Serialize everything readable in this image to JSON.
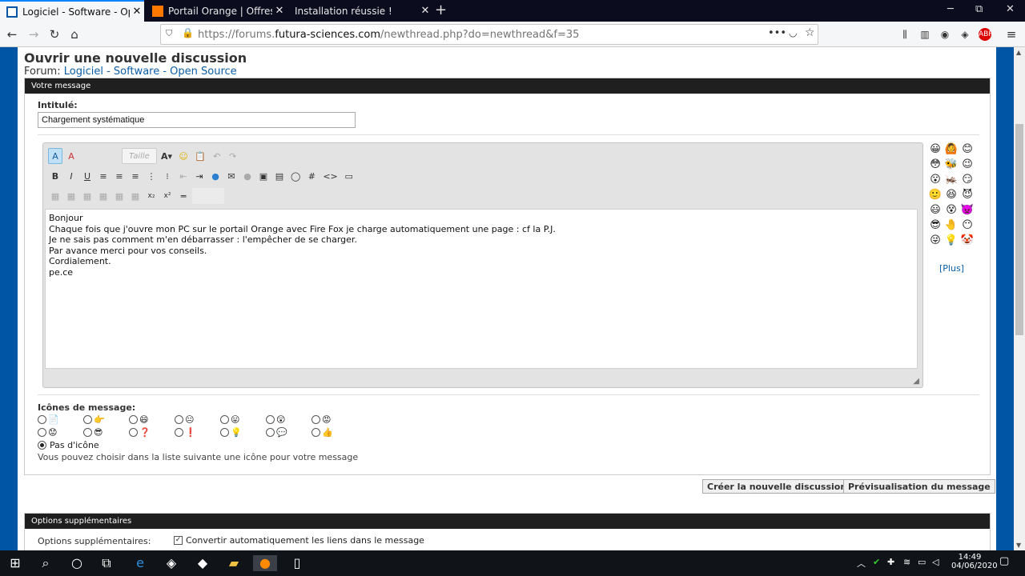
{
  "tabs": [
    {
      "title": "Logiciel - Software - Open",
      "close": "✕",
      "active": true
    },
    {
      "title": "Portail Orange | Offres Mo",
      "close": "✕",
      "active": false
    },
    {
      "title": "Installation réussie !",
      "close": "✕",
      "active": false
    }
  ],
  "newtab": "+",
  "window": {
    "min": "─",
    "max": "⧉",
    "close": "✕"
  },
  "url": {
    "prefix": "https://forums.",
    "domain": "futura-sciences.com",
    "path": "/newthread.php?do=newthread&f=35"
  },
  "page": {
    "title": "Ouvrir une nouvelle discussion",
    "forum_label": "Forum:",
    "forum_link": "Logiciel - Software - Open Source",
    "section_message": "Votre message",
    "intitule_label": "Intitulé:",
    "intitule_value": "Chargement systématique",
    "font_placeholder": "Taille",
    "message_text": "Bonjour\nChaque fois que j'ouvre mon PC sur le portail Orange avec Fire Fox je charge automatiquement une page : cf la P.J.\nJe ne sais pas comment m'en débarrasser : l'empêcher de se charger.\nPar avance merci pour vos conseils.\nCordialement.\npe.ce",
    "plus_link": "[Plus]",
    "icons_label": "Icônes de message:",
    "no_icon": "Pas d'icône",
    "icons_hint": "Vous pouvez choisir dans la liste suivante une icône pour votre message",
    "btn_create": "Créer la nouvelle discussion",
    "btn_preview": "Prévisualisation du message",
    "section_options": "Options supplémentaires",
    "options_label": "Options supplémentaires:",
    "option_links": "Convertir automatiquement les liens dans le message"
  },
  "taskbar": {
    "time": "14:49",
    "date": "04/06/2020"
  },
  "colors": {
    "accent": "#0055a4",
    "tabbar": "#0c0c1f",
    "header": "#1f1f1f",
    "link": "#0b5ea5"
  }
}
